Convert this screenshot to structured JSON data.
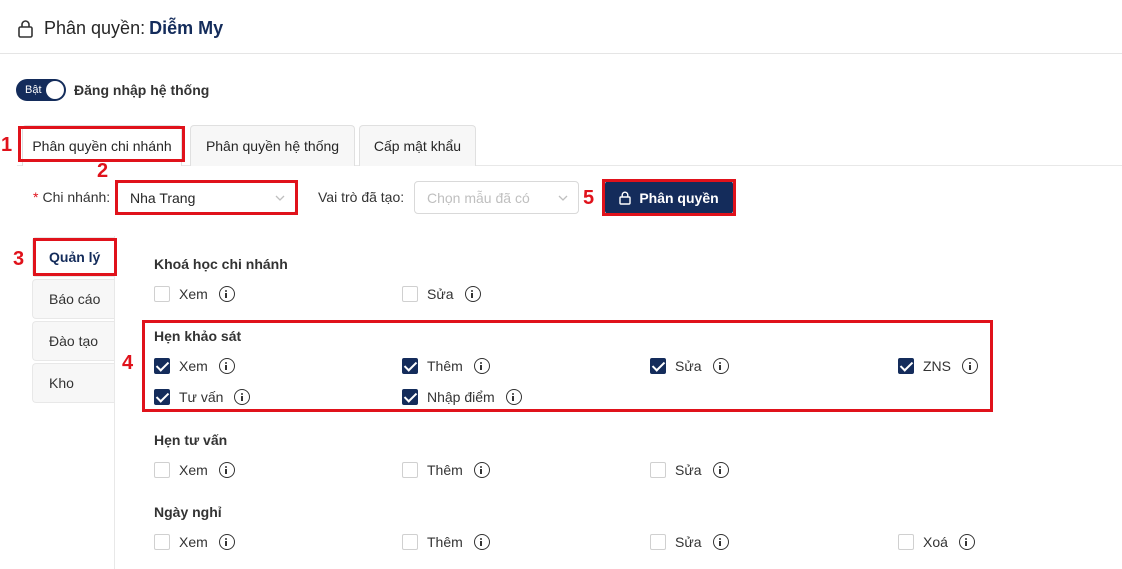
{
  "header": {
    "title": "Phân quyền:",
    "user_name": "Diễm My"
  },
  "login_toggle": {
    "state_label": "Bật",
    "label": "Đăng nhập hệ thống"
  },
  "tabs": [
    {
      "label": "Phân quyền chi nhánh"
    },
    {
      "label": "Phân quyền hệ thống"
    },
    {
      "label": "Cấp mật khẩu"
    }
  ],
  "annotations": [
    "1",
    "2",
    "3",
    "4",
    "5"
  ],
  "branch": {
    "label": "Chi nhánh:",
    "required_mark": "*",
    "value": "Nha Trang"
  },
  "role": {
    "label": "Vai trò đã tạo:",
    "placeholder": "Chọn mẫu đã có"
  },
  "assign_button": {
    "label": "Phân quyền"
  },
  "side_menu": [
    {
      "label": "Quản lý"
    },
    {
      "label": "Báo cáo"
    },
    {
      "label": "Đào tạo"
    },
    {
      "label": "Kho"
    }
  ],
  "groups": [
    {
      "title": "Khoá học chi nhánh",
      "perms": [
        {
          "label": "Xem",
          "checked": false
        },
        {
          "label": "Sửa",
          "checked": false
        }
      ]
    },
    {
      "title": "Hẹn khảo sát",
      "perms": [
        {
          "label": "Xem",
          "checked": true
        },
        {
          "label": "Thêm",
          "checked": true
        },
        {
          "label": "Sửa",
          "checked": true
        },
        {
          "label": "ZNS",
          "checked": true
        },
        {
          "label": "Tư vấn",
          "checked": true
        },
        {
          "label": "Nhập điểm",
          "checked": true
        }
      ]
    },
    {
      "title": "Hẹn tư vấn",
      "perms": [
        {
          "label": "Xem",
          "checked": false
        },
        {
          "label": "Thêm",
          "checked": false
        },
        {
          "label": "Sửa",
          "checked": false
        }
      ]
    },
    {
      "title": "Ngày nghỉ",
      "perms": [
        {
          "label": "Xem",
          "checked": false
        },
        {
          "label": "Thêm",
          "checked": false
        },
        {
          "label": "Sửa",
          "checked": false
        },
        {
          "label": "Xoá",
          "checked": false
        }
      ]
    }
  ],
  "colors": {
    "primary": "#142c5b",
    "annotation": "#e0121b"
  }
}
